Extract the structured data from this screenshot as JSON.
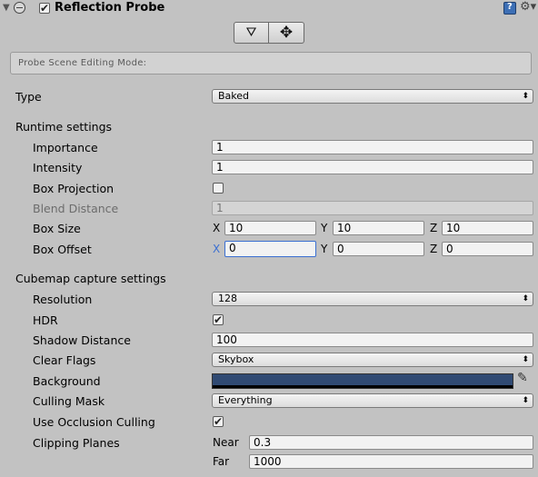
{
  "header": {
    "title": "Reflection Probe",
    "enabled_check": "✔",
    "foldout_glyph": "▼",
    "gear_glyph": "⚙▾"
  },
  "edit_buttons": {
    "edit_bounds_glyph": "⛛",
    "move_glyph": "✥"
  },
  "probe_scene_editing_mode": "Probe Scene Editing Mode:",
  "type": {
    "label": "Type",
    "value": "Baked"
  },
  "runtime": {
    "section_label": "Runtime settings",
    "importance": {
      "label": "Importance",
      "value": "1"
    },
    "intensity": {
      "label": "Intensity",
      "value": "1"
    },
    "box_projection": {
      "label": "Box Projection",
      "checked": ""
    },
    "blend_distance": {
      "label": "Blend Distance",
      "value": "1"
    },
    "box_size": {
      "label": "Box Size",
      "x_axis": "X",
      "x": "10",
      "y_axis": "Y",
      "y": "10",
      "z_axis": "Z",
      "z": "10"
    },
    "box_offset": {
      "label": "Box Offset",
      "x_axis": "X",
      "x": "0",
      "y_axis": "Y",
      "y": "0",
      "z_axis": "Z",
      "z": "0"
    }
  },
  "cubemap": {
    "section_label": "Cubemap capture settings",
    "resolution": {
      "label": "Resolution",
      "value": "128"
    },
    "hdr": {
      "label": "HDR",
      "checked": "✔"
    },
    "shadow_distance": {
      "label": "Shadow Distance",
      "value": "100"
    },
    "clear_flags": {
      "label": "Clear Flags",
      "value": "Skybox"
    },
    "background": {
      "label": "Background",
      "color": "#304a73"
    },
    "culling_mask": {
      "label": "Culling Mask",
      "value": "Everything"
    },
    "occlusion_culling": {
      "label": "Use Occlusion Culling",
      "checked": "✔"
    },
    "clipping_planes": {
      "label": "Clipping Planes",
      "near_label": "Near",
      "near": "0.3",
      "far_label": "Far",
      "far": "1000"
    }
  },
  "popup_arrow": "⬍",
  "picker_glyph": "✎"
}
